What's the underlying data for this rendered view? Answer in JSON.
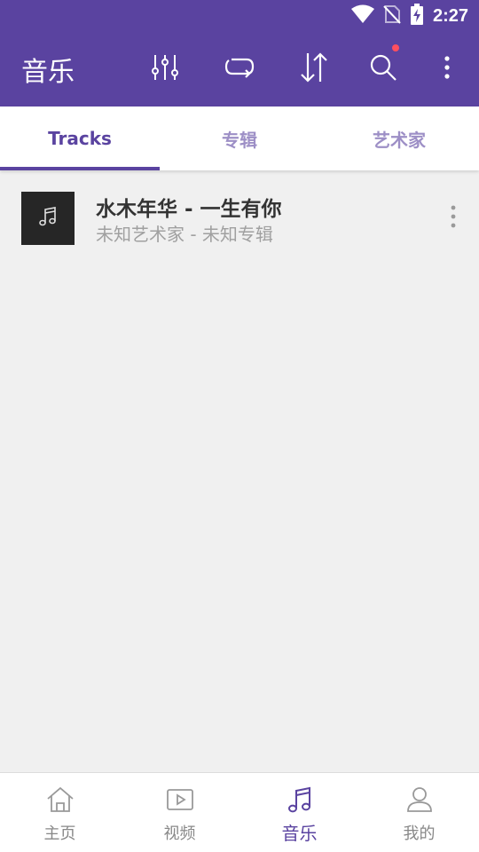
{
  "status_bar": {
    "time": "2:27",
    "icons": [
      "wifi-icon",
      "no-sim-icon",
      "battery-charging-icon"
    ]
  },
  "app_bar": {
    "title": "音乐",
    "actions": [
      "equalizer-icon",
      "repeat-icon",
      "sort-icon",
      "search-icon",
      "more-vert-icon"
    ],
    "notification_dot_color": "#ff4f5e"
  },
  "tabs": [
    {
      "label": "Tracks",
      "active": true
    },
    {
      "label": "专辑",
      "active": false
    },
    {
      "label": "艺术家",
      "active": false
    }
  ],
  "tracks": [
    {
      "title": "水木年华 - 一生有你",
      "subtitle": "未知艺术家 - 未知专辑",
      "icon": "music-note-icon"
    }
  ],
  "bottom_nav": [
    {
      "label": "主页",
      "icon": "home-icon",
      "active": false
    },
    {
      "label": "视频",
      "icon": "video-icon",
      "active": false
    },
    {
      "label": "音乐",
      "icon": "music-note-icon",
      "active": true
    },
    {
      "label": "我的",
      "icon": "profile-icon",
      "active": false
    }
  ],
  "colors": {
    "primary": "#5a43a0",
    "tab_inactive": "#9d8fc6",
    "background": "#f0f0f0"
  }
}
